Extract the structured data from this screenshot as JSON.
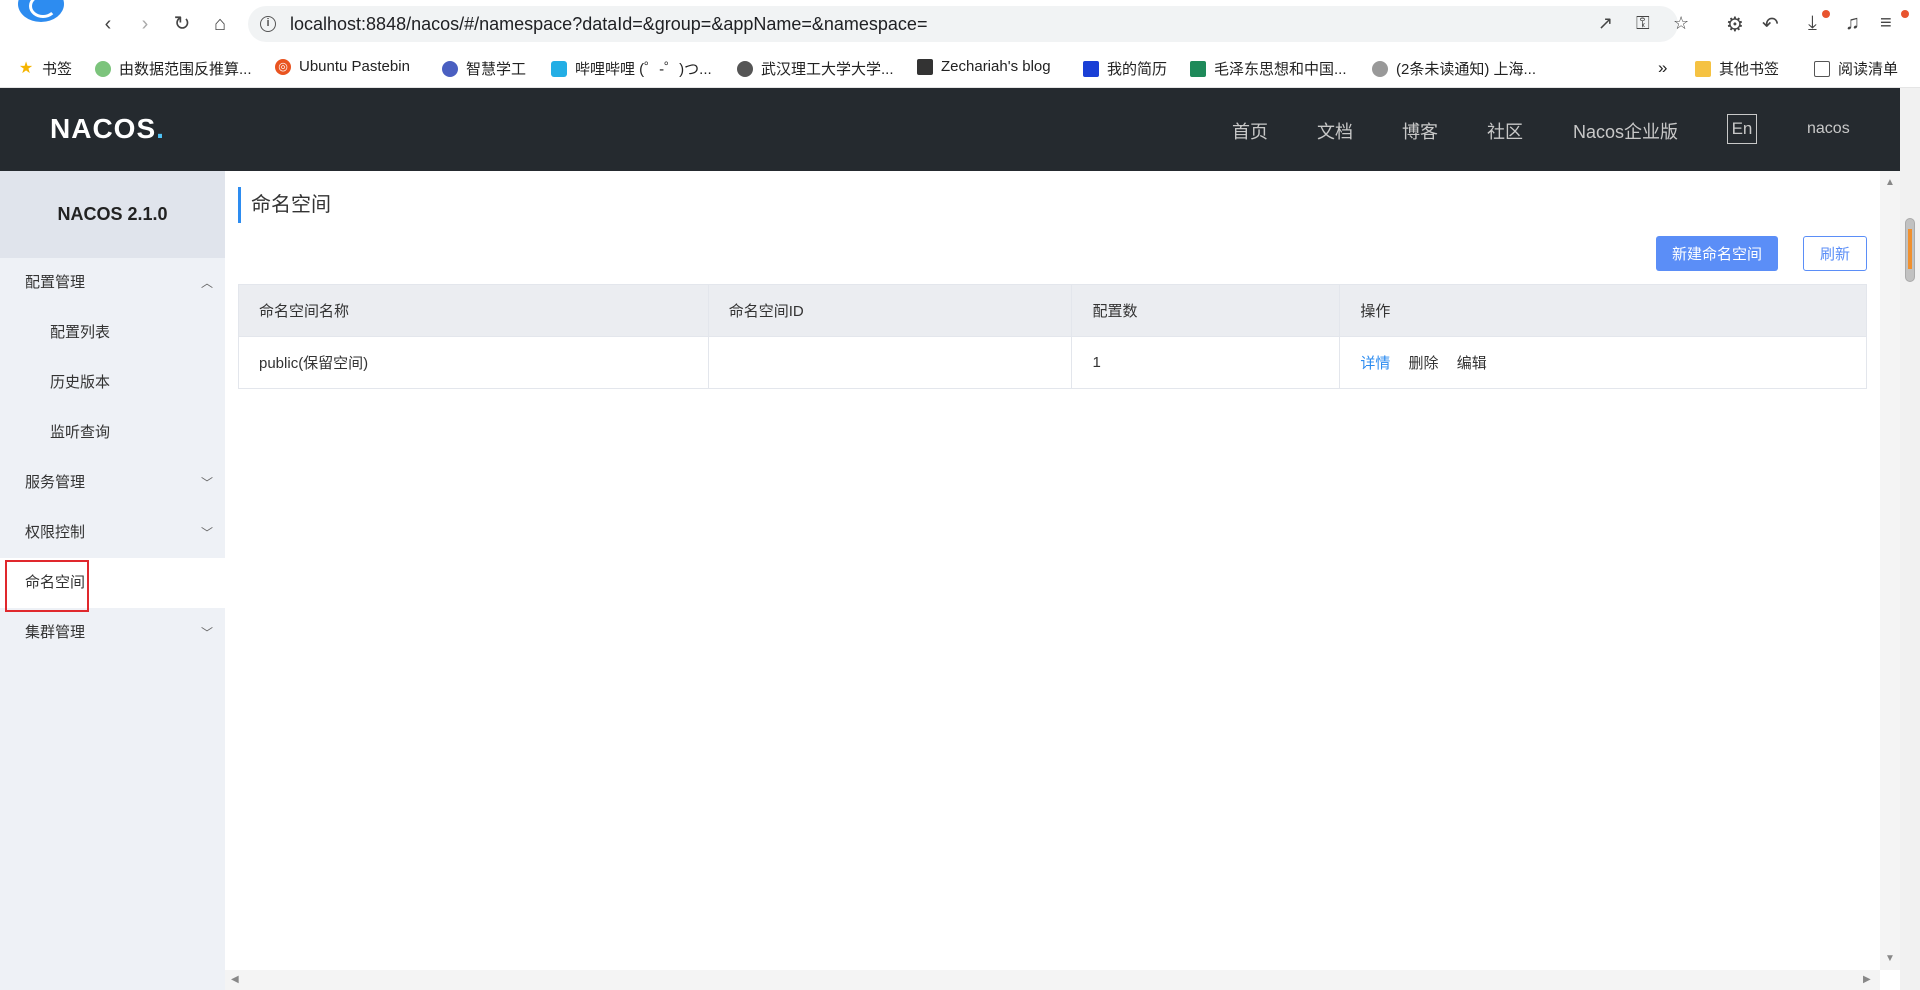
{
  "browser": {
    "url": "localhost:8848/nacos/#/namespace?dataId=&group=&appName=&namespace=",
    "bookmarks": [
      {
        "label": "书签",
        "icon": "star-icon"
      },
      {
        "label": "由数据范围反推算...",
        "icon": "site-icon"
      },
      {
        "label": "Ubuntu Pastebin",
        "icon": "ubuntu-icon"
      },
      {
        "label": "智慧学工",
        "icon": "site-icon"
      },
      {
        "label": "哔哩哔哩 (゜-゜)つ...",
        "icon": "bilibili-icon"
      },
      {
        "label": "武汉理工大学大学...",
        "icon": "site-icon"
      },
      {
        "label": "Zechariah's blog",
        "icon": "site-icon"
      },
      {
        "label": "我的简历",
        "icon": "site-icon"
      },
      {
        "label": "毛泽东思想和中国...",
        "icon": "site-icon"
      },
      {
        "label": "(2条未读通知) 上海...",
        "icon": "site-icon"
      }
    ],
    "more_bookmarks": "»",
    "other_bookmarks": "其他书签",
    "reading_list": "阅读清单"
  },
  "header": {
    "logo": "NACOS",
    "nav": [
      "首页",
      "文档",
      "博客",
      "社区",
      "Nacos企业版"
    ],
    "lang": "En",
    "user": "nacos"
  },
  "sidebar": {
    "version": "NACOS 2.1.0",
    "config_mgmt": "配置管理",
    "config_list": "配置列表",
    "history": "历史版本",
    "listen_query": "监听查询",
    "service_mgmt": "服务管理",
    "auth_control": "权限控制",
    "namespace": "命名空间",
    "cluster_mgmt": "集群管理"
  },
  "main": {
    "title": "命名空间",
    "new_button": "新建命名空间",
    "refresh_button": "刷新",
    "columns": [
      "命名空间名称",
      "命名空间ID",
      "配置数",
      "操作"
    ],
    "rows": [
      {
        "name": "public(保留空间)",
        "id": "",
        "count": "1",
        "ops": [
          "详情",
          "删除",
          "编辑"
        ]
      }
    ]
  }
}
